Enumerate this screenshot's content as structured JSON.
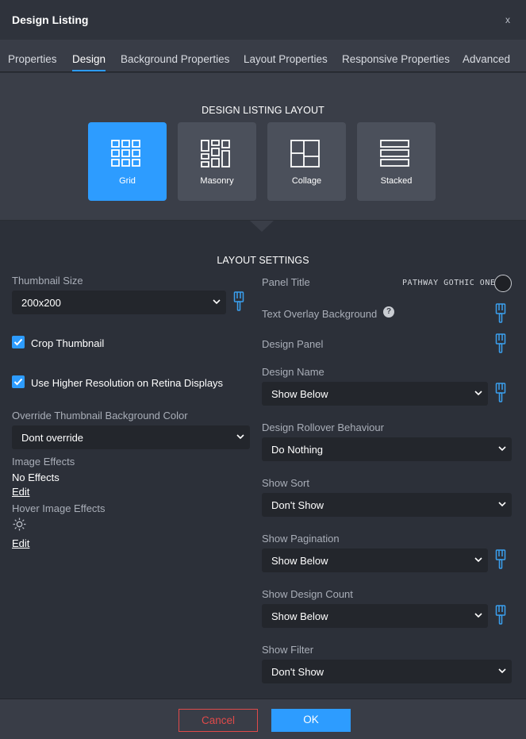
{
  "dialog": {
    "title": "Design Listing",
    "close_label": "x"
  },
  "tabs": [
    {
      "label": "Properties"
    },
    {
      "label": "Design"
    },
    {
      "label": "Background Properties"
    },
    {
      "label": "Layout Properties"
    },
    {
      "label": "Responsive Properties"
    },
    {
      "label": "Advanced"
    }
  ],
  "active_tab": "Design",
  "layout_section": {
    "heading": "DESIGN LISTING LAYOUT",
    "options": [
      {
        "label": "Grid",
        "icon": "grid-icon"
      },
      {
        "label": "Masonry",
        "icon": "masonry-icon"
      },
      {
        "label": "Collage",
        "icon": "collage-icon"
      },
      {
        "label": "Stacked",
        "icon": "stacked-icon"
      }
    ],
    "selected": "Grid"
  },
  "settings": {
    "heading": "LAYOUT SETTINGS",
    "left": {
      "thumbnail_size": {
        "label": "Thumbnail Size",
        "value": "200x200"
      },
      "crop_thumbnail": {
        "label": "Crop Thumbnail",
        "checked": true
      },
      "retina": {
        "label": "Use Higher Resolution on Retina Displays",
        "checked": true
      },
      "override_bg": {
        "label": "Override Thumbnail Background Color",
        "value": "Dont override"
      },
      "image_effects": {
        "label": "Image Effects",
        "value": "No Effects",
        "edit": "Edit"
      },
      "hover_effects": {
        "label": "Hover Image Effects",
        "edit": "Edit"
      }
    },
    "right": {
      "panel_title": {
        "label": "Panel Title",
        "font": "PATHWAY GOTHIC ONE"
      },
      "text_overlay": {
        "label": "Text Overlay Background",
        "help": "?"
      },
      "design_panel": {
        "label": "Design Panel"
      },
      "design_name": {
        "label": "Design Name",
        "value": "Show Below"
      },
      "rollover": {
        "label": "Design Rollover Behaviour",
        "value": "Do Nothing"
      },
      "show_sort": {
        "label": "Show Sort",
        "value": "Don't Show"
      },
      "show_pagination": {
        "label": "Show Pagination",
        "value": "Show Below"
      },
      "show_design_count": {
        "label": "Show Design Count",
        "value": "Show Below"
      },
      "show_filter": {
        "label": "Show Filter",
        "value": "Don't Show"
      }
    }
  },
  "footer": {
    "cancel": "Cancel",
    "ok": "OK"
  },
  "colors": {
    "accent": "#2d9cff",
    "cancel": "#e04a4a",
    "brush": "#3aa0f0"
  }
}
